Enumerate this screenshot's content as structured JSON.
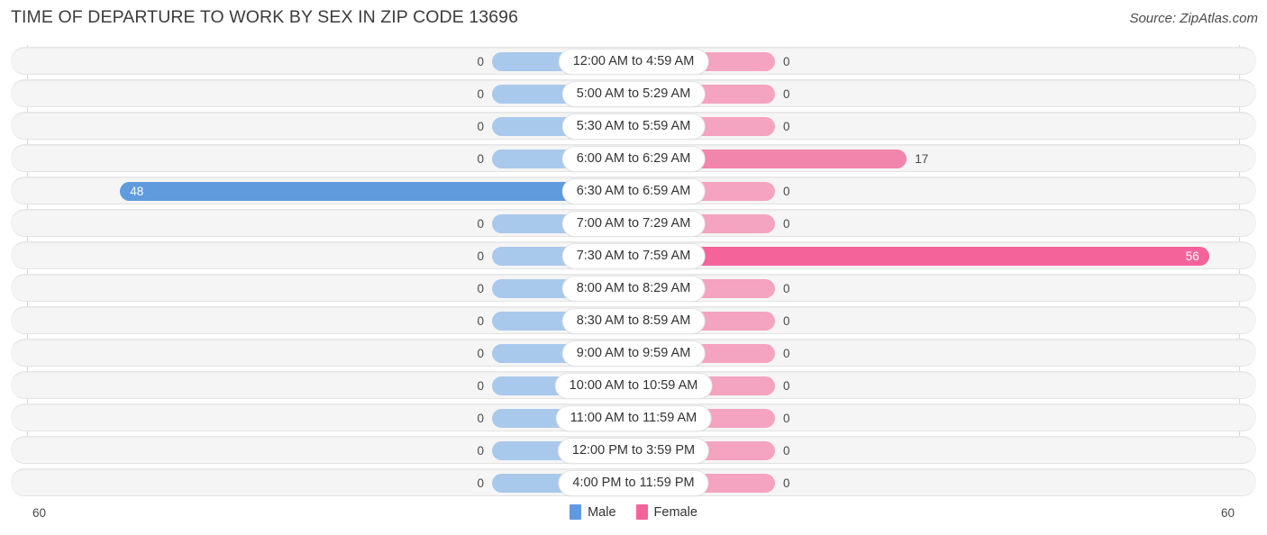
{
  "header": {
    "title": "TIME OF DEPARTURE TO WORK BY SEX IN ZIP CODE 13696",
    "source": "Source: ZipAtlas.com"
  },
  "legend": {
    "male_label": "Male",
    "female_label": "Female",
    "male_color": "#5f9bdd",
    "female_color": "#f4649a"
  },
  "axis": {
    "left_max": "60",
    "right_max": "60"
  },
  "colors": {
    "male_zero": "#a9c9ec",
    "male_strong": "#5f9bdd",
    "female_zero": "#f4a3c0",
    "female_mid": "#f285ab",
    "female_strong": "#f4649a",
    "row_background": "#f5f5f5",
    "pill_background": "#ffffff"
  },
  "chart_data": {
    "type": "bar",
    "orientation": "horizontal-diverging",
    "title": "TIME OF DEPARTURE TO WORK BY SEX IN ZIP CODE 13696",
    "xlabel": "",
    "ylabel": "",
    "xlim": [
      60,
      60
    ],
    "grid": false,
    "legend_position": "bottom-center",
    "categories": [
      "12:00 AM to 4:59 AM",
      "5:00 AM to 5:29 AM",
      "5:30 AM to 5:59 AM",
      "6:00 AM to 6:29 AM",
      "6:30 AM to 6:59 AM",
      "7:00 AM to 7:29 AM",
      "7:30 AM to 7:59 AM",
      "8:00 AM to 8:29 AM",
      "8:30 AM to 8:59 AM",
      "9:00 AM to 9:59 AM",
      "10:00 AM to 10:59 AM",
      "11:00 AM to 11:59 AM",
      "12:00 PM to 3:59 PM",
      "4:00 PM to 11:59 PM"
    ],
    "series": [
      {
        "name": "Male",
        "values": [
          0,
          0,
          0,
          0,
          48,
          0,
          0,
          0,
          0,
          0,
          0,
          0,
          0,
          0
        ]
      },
      {
        "name": "Female",
        "values": [
          0,
          0,
          0,
          17,
          0,
          0,
          56,
          0,
          0,
          0,
          0,
          0,
          0,
          0
        ]
      }
    ]
  },
  "rows": [
    {
      "category": "12:00 AM to 4:59 AM",
      "male": "0",
      "female": "0"
    },
    {
      "category": "5:00 AM to 5:29 AM",
      "male": "0",
      "female": "0"
    },
    {
      "category": "5:30 AM to 5:59 AM",
      "male": "0",
      "female": "0"
    },
    {
      "category": "6:00 AM to 6:29 AM",
      "male": "0",
      "female": "17"
    },
    {
      "category": "6:30 AM to 6:59 AM",
      "male": "48",
      "female": "0"
    },
    {
      "category": "7:00 AM to 7:29 AM",
      "male": "0",
      "female": "0"
    },
    {
      "category": "7:30 AM to 7:59 AM",
      "male": "0",
      "female": "56"
    },
    {
      "category": "8:00 AM to 8:29 AM",
      "male": "0",
      "female": "0"
    },
    {
      "category": "8:30 AM to 8:59 AM",
      "male": "0",
      "female": "0"
    },
    {
      "category": "9:00 AM to 9:59 AM",
      "male": "0",
      "female": "0"
    },
    {
      "category": "10:00 AM to 10:59 AM",
      "male": "0",
      "female": "0"
    },
    {
      "category": "11:00 AM to 11:59 AM",
      "male": "0",
      "female": "0"
    },
    {
      "category": "12:00 PM to 3:59 PM",
      "male": "0",
      "female": "0"
    },
    {
      "category": "4:00 PM to 11:59 PM",
      "male": "0",
      "female": "0"
    }
  ]
}
